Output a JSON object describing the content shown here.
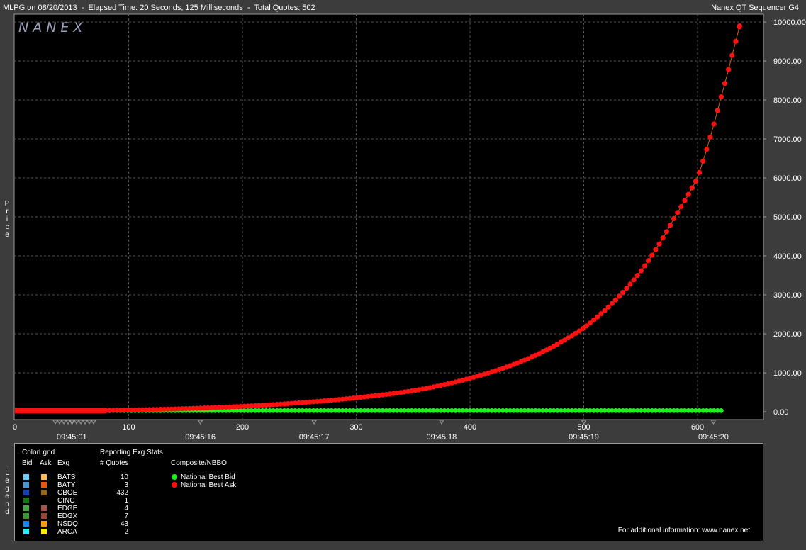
{
  "header": {
    "title": "MLPG on 08/20/2013  -  Elapsed Time: 20 Seconds, 125 Milliseconds  -  Total Quotes: 502",
    "app_name": "Nanex QT Sequencer G4",
    "watermark": "NANEX"
  },
  "side_labels": {
    "price": "Price",
    "legend": "Legend"
  },
  "chart_data": {
    "type": "scatter",
    "x_ticks": [
      0,
      100,
      200,
      300,
      400,
      500,
      600
    ],
    "x_range": [
      0,
      625
    ],
    "time_ticks": [
      {
        "x": 50,
        "label": "09:45:01"
      },
      {
        "x": 163,
        "label": "09:45:16"
      },
      {
        "x": 263,
        "label": "09:45:17"
      },
      {
        "x": 375,
        "label": "09:45:18"
      },
      {
        "x": 500,
        "label": "09:45:19"
      },
      {
        "x": 614,
        "label": "09:45:20"
      }
    ],
    "y_ticks": [
      "10000.00",
      "9000.00",
      "8000.00",
      "7000.00",
      "6000.00",
      "5000.00",
      "4000.00",
      "3000.00",
      "2000.00",
      "1000.00",
      "0.00"
    ],
    "y_range": [
      0,
      10000
    ],
    "grid": true,
    "series": [
      {
        "name": "National Best Bid",
        "color": "#22ee22",
        "values": [
          [
            0,
            0
          ],
          [
            80,
            30
          ],
          [
            622,
            30
          ]
        ]
      },
      {
        "name": "National Best Ask",
        "color": "#ff1111",
        "values": [
          [
            0,
            30
          ],
          [
            80,
            30
          ],
          [
            100,
            45
          ],
          [
            150,
            80
          ],
          [
            200,
            140
          ],
          [
            250,
            230
          ],
          [
            300,
            360
          ],
          [
            350,
            540
          ],
          [
            400,
            860
          ],
          [
            450,
            1350
          ],
          [
            500,
            2150
          ],
          [
            550,
            3600
          ],
          [
            580,
            5000
          ],
          [
            600,
            6000
          ],
          [
            620,
            8000
          ],
          [
            630,
            9100
          ],
          [
            637,
            9900
          ]
        ]
      }
    ]
  },
  "legend": {
    "colorlgnd_header": "ColorLgnd",
    "bid_header": "Bid",
    "ask_header": "Ask",
    "exg_header": "Exg",
    "stats_header": "Reporting Exg Stats",
    "quotes_header": "# Quotes",
    "composite_header": "Composite/NBBO",
    "exchanges": [
      {
        "name": "BATS",
        "quotes": "10",
        "bid_color": "#66ccff",
        "ask_color": "#ffbb55"
      },
      {
        "name": "BATY",
        "quotes": "3",
        "bid_color": "#4499dd",
        "ask_color": "#ee5500"
      },
      {
        "name": "CBOE",
        "quotes": "432",
        "bid_color": "#1144bb",
        "ask_color": "#996611"
      },
      {
        "name": "CINC",
        "quotes": "1",
        "bid_color": "#117711",
        "ask_color": ""
      },
      {
        "name": "EDGE",
        "quotes": "4",
        "bid_color": "#44aa44",
        "ask_color": "#aa5544"
      },
      {
        "name": "EDGX",
        "quotes": "7",
        "bid_color": "#339933",
        "ask_color": "#994433"
      },
      {
        "name": "NSDQ",
        "quotes": "43",
        "bid_color": "#1188ff",
        "ask_color": "#ff9900"
      },
      {
        "name": "ARCA",
        "quotes": "2",
        "bid_color": "#22eeff",
        "ask_color": "#ffee00"
      }
    ],
    "nbbo": [
      {
        "name": "National Best Bid",
        "color": "#22ee22"
      },
      {
        "name": "National Best Ask",
        "color": "#ff1111"
      }
    ],
    "footer": "For additional information: www.nanex.net"
  }
}
